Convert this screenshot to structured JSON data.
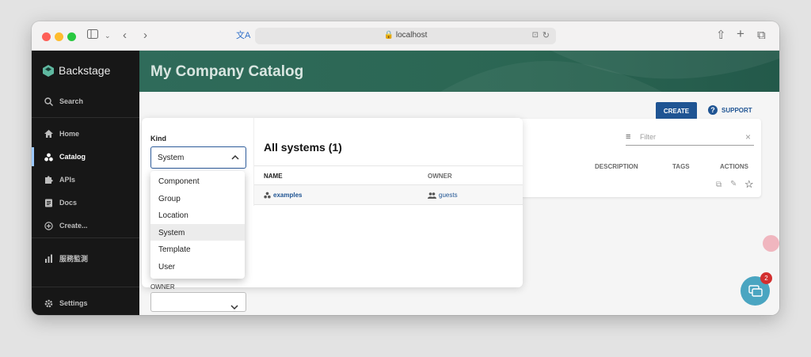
{
  "browser": {
    "address": "localhost"
  },
  "sidebar": {
    "brand": "Backstage",
    "search_label": "Search",
    "items": [
      {
        "label": "Home",
        "icon": "home-icon"
      },
      {
        "label": "Catalog",
        "icon": "catalog-icon"
      },
      {
        "label": "APIs",
        "icon": "puzzle-icon"
      },
      {
        "label": "Docs",
        "icon": "docs-icon"
      },
      {
        "label": "Create...",
        "icon": "plus-circle-icon"
      }
    ],
    "extra_item": {
      "label": "服務監測",
      "icon": "bar-chart-icon"
    },
    "settings_label": "Settings"
  },
  "header": {
    "title": "My Company Catalog"
  },
  "toolbar": {
    "create_label": "CREATE",
    "support_label": "SUPPORT"
  },
  "table": {
    "filter_placeholder": "Filter",
    "columns": [
      "DESCRIPTION",
      "TAGS",
      "ACTIONS"
    ]
  },
  "kind_filter": {
    "label": "Kind",
    "selected": "System",
    "options": [
      "Component",
      "Group",
      "Location",
      "System",
      "Template",
      "User"
    ]
  },
  "owner_filter": {
    "label": "OWNER"
  },
  "systems": {
    "title": "All systems (1)",
    "columns": {
      "name": "NAME",
      "owner": "OWNER"
    },
    "rows": [
      {
        "name": "examples",
        "owner": "guests"
      }
    ]
  },
  "notifications": {
    "count": "2"
  },
  "colors": {
    "accent": "#1f5493",
    "header": "#2b6653",
    "sidebar": "#171717"
  }
}
